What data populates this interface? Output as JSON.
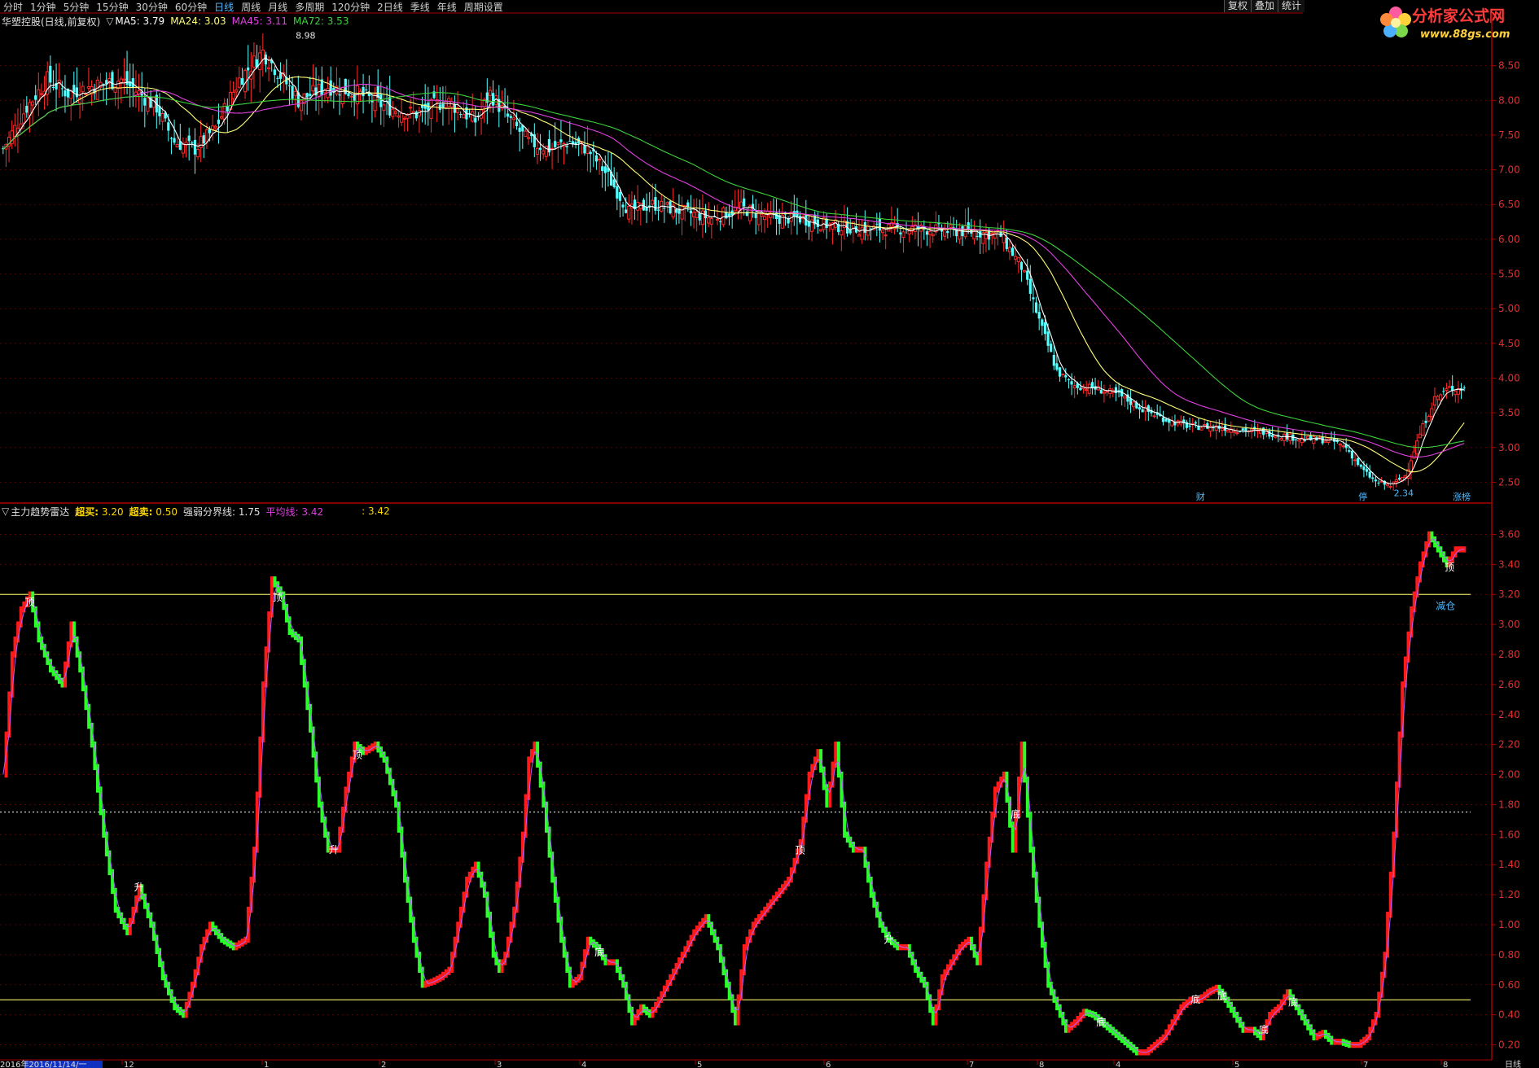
{
  "toolbar": {
    "periods": [
      "分时",
      "1分钟",
      "5分钟",
      "15分钟",
      "30分钟",
      "60分钟",
      "日线",
      "周线",
      "月线",
      "多周期",
      "120分钟",
      "2日线",
      "季线",
      "年线",
      "周期设置"
    ],
    "active": "日线",
    "right_buttons": [
      "复权",
      "叠加",
      "统计"
    ]
  },
  "logo": {
    "name": "分析家公式网",
    "url": "www.88gs.com"
  },
  "main_legend": {
    "title": "华塑控股(日线,前复权)",
    "ma5": "MA5: 3.79",
    "ma24": "MA24: 3.03",
    "ma45": "MA45: 3.11",
    "ma72": "MA72: 3.53"
  },
  "ind_legend": {
    "title": "主力趋势雷达",
    "buy_label": "超买:",
    "buy_value": "3.20",
    "sell_label": "超卖:",
    "sell_value": "0.50",
    "divider": "强弱分界线: 1.75",
    "avg": "平均线: 3.42",
    "val": ": 3.42"
  },
  "colors": {
    "up": "#ff2a2a",
    "down": "#54ffff",
    "ma5": "#ffffff",
    "ma24": "#ffff7a",
    "ma45": "#e040e0",
    "ma72": "#3cd23c",
    "ind_up": "#ff1a1a",
    "ind_down": "#2aff2a",
    "axis": "#aa0000",
    "grid": "#6a0000"
  },
  "price_axis": [
    "8.50",
    "8.00",
    "7.50",
    "7.00",
    "6.50",
    "6.00",
    "5.50",
    "5.00",
    "4.50",
    "4.00",
    "3.50",
    "3.00",
    "2.50"
  ],
  "ind_axis": [
    "3.60",
    "3.40",
    "3.20",
    "3.00",
    "2.80",
    "2.60",
    "2.40",
    "2.20",
    "2.00",
    "1.80",
    "1.60",
    "1.40",
    "1.20",
    "1.00",
    "0.80",
    "0.60",
    "0.40",
    "0.20"
  ],
  "date_bar": {
    "label": "2016年2016/11/14/一",
    "ticks": [
      "12",
      "1",
      "2",
      "3",
      "4",
      "5",
      "6",
      "7",
      "8",
      "4",
      "5",
      "7",
      "8"
    ],
    "period": "日线"
  },
  "chart_data": [
    {
      "type": "candlestick",
      "title": "华塑控股(日线,前复权)",
      "ylim": [
        2.2,
        9.0
      ],
      "series": [
        {
          "name": "MA5",
          "value": 3.79
        },
        {
          "name": "MA24",
          "value": 3.03
        },
        {
          "name": "MA45",
          "value": 3.11
        },
        {
          "name": "MA72",
          "value": 3.53
        }
      ],
      "close_anchors": [
        [
          0,
          7.3
        ],
        [
          8,
          7.9
        ],
        [
          15,
          8.3
        ],
        [
          22,
          8.1
        ],
        [
          30,
          8.2
        ],
        [
          40,
          8.3
        ],
        [
          52,
          7.9
        ],
        [
          58,
          7.4
        ],
        [
          65,
          7.3
        ],
        [
          72,
          7.6
        ],
        [
          80,
          8.3
        ],
        [
          88,
          8.7
        ],
        [
          95,
          8.3
        ],
        [
          100,
          8.0
        ],
        [
          110,
          8.2
        ],
        [
          120,
          8.1
        ],
        [
          130,
          7.9
        ],
        [
          140,
          7.8
        ],
        [
          150,
          8.0
        ],
        [
          160,
          7.7
        ],
        [
          165,
          8.1
        ],
        [
          170,
          7.8
        ],
        [
          178,
          7.4
        ],
        [
          185,
          7.3
        ],
        [
          192,
          7.4
        ],
        [
          198,
          7.3
        ],
        [
          205,
          6.9
        ],
        [
          212,
          6.4
        ],
        [
          220,
          6.5
        ],
        [
          230,
          6.4
        ],
        [
          240,
          6.3
        ],
        [
          250,
          6.45
        ],
        [
          260,
          6.3
        ],
        [
          270,
          6.3
        ],
        [
          280,
          6.2
        ],
        [
          290,
          6.15
        ],
        [
          300,
          6.15
        ],
        [
          310,
          6.15
        ],
        [
          320,
          6.12
        ],
        [
          330,
          6.1
        ],
        [
          338,
          6.05
        ],
        [
          345,
          5.6
        ],
        [
          352,
          4.7
        ],
        [
          357,
          4.1
        ],
        [
          362,
          3.9
        ],
        [
          370,
          3.85
        ],
        [
          378,
          3.75
        ],
        [
          386,
          3.55
        ],
        [
          394,
          3.4
        ],
        [
          402,
          3.3
        ],
        [
          410,
          3.3
        ],
        [
          420,
          3.25
        ],
        [
          430,
          3.2
        ],
        [
          440,
          3.12
        ],
        [
          450,
          3.1
        ],
        [
          455,
          3.0
        ],
        [
          460,
          2.7
        ],
        [
          465,
          2.5
        ],
        [
          470,
          2.45
        ],
        [
          475,
          2.6
        ],
        [
          480,
          3.2
        ],
        [
          485,
          3.7
        ],
        [
          490,
          3.85
        ]
      ],
      "annotations": [
        {
          "text": "8.98",
          "x": 98
        },
        {
          "text": "2.34",
          "x": 470
        },
        {
          "text": "财",
          "x": 403
        },
        {
          "text": "停",
          "x": 458
        },
        {
          "text": "涨榜",
          "x": 490
        }
      ]
    },
    {
      "type": "bar",
      "title": "主力趋势雷达",
      "ylim": [
        0.1,
        3.7
      ],
      "reference_lines": {
        "超买": 3.2,
        "超卖": 0.5,
        "强弱分界线": 1.75
      },
      "anchors": [
        [
          0,
          2.0
        ],
        [
          3,
          2.8
        ],
        [
          6,
          3.1
        ],
        [
          9,
          3.2
        ],
        [
          12,
          2.9
        ],
        [
          16,
          2.7
        ],
        [
          20,
          2.6
        ],
        [
          23,
          3.0
        ],
        [
          26,
          2.7
        ],
        [
          30,
          2.2
        ],
        [
          34,
          1.6
        ],
        [
          38,
          1.1
        ],
        [
          42,
          0.95
        ],
        [
          46,
          1.25
        ],
        [
          50,
          1.0
        ],
        [
          54,
          0.65
        ],
        [
          58,
          0.45
        ],
        [
          61,
          0.4
        ],
        [
          64,
          0.6
        ],
        [
          67,
          0.85
        ],
        [
          70,
          1.0
        ],
        [
          74,
          0.9
        ],
        [
          78,
          0.85
        ],
        [
          82,
          0.9
        ],
        [
          85,
          1.5
        ],
        [
          88,
          2.6
        ],
        [
          91,
          3.3
        ],
        [
          94,
          3.2
        ],
        [
          97,
          2.95
        ],
        [
          100,
          2.9
        ],
        [
          104,
          2.3
        ],
        [
          107,
          1.8
        ],
        [
          110,
          1.5
        ],
        [
          113,
          1.5
        ],
        [
          116,
          1.9
        ],
        [
          119,
          2.2
        ],
        [
          122,
          2.15
        ],
        [
          126,
          2.2
        ],
        [
          129,
          2.1
        ],
        [
          133,
          1.8
        ],
        [
          136,
          1.3
        ],
        [
          139,
          0.9
        ],
        [
          142,
          0.6
        ],
        [
          145,
          0.62
        ],
        [
          148,
          0.65
        ],
        [
          151,
          0.7
        ],
        [
          154,
          1.0
        ],
        [
          157,
          1.3
        ],
        [
          160,
          1.4
        ],
        [
          163,
          1.2
        ],
        [
          166,
          0.8
        ],
        [
          168,
          0.7
        ],
        [
          170,
          0.8
        ],
        [
          173,
          1.1
        ],
        [
          176,
          1.6
        ],
        [
          178,
          2.1
        ],
        [
          180,
          2.2
        ],
        [
          183,
          1.8
        ],
        [
          186,
          1.3
        ],
        [
          189,
          0.9
        ],
        [
          192,
          0.6
        ],
        [
          195,
          0.65
        ],
        [
          198,
          0.9
        ],
        [
          201,
          0.85
        ],
        [
          204,
          0.75
        ],
        [
          207,
          0.75
        ],
        [
          210,
          0.6
        ],
        [
          213,
          0.35
        ],
        [
          216,
          0.45
        ],
        [
          219,
          0.4
        ],
        [
          222,
          0.5
        ],
        [
          226,
          0.65
        ],
        [
          230,
          0.8
        ],
        [
          234,
          0.95
        ],
        [
          238,
          1.05
        ],
        [
          242,
          0.85
        ],
        [
          245,
          0.6
        ],
        [
          248,
          0.35
        ],
        [
          251,
          0.85
        ],
        [
          254,
          1.0
        ],
        [
          258,
          1.1
        ],
        [
          262,
          1.2
        ],
        [
          266,
          1.3
        ],
        [
          270,
          1.55
        ],
        [
          273,
          2.0
        ],
        [
          276,
          2.15
        ],
        [
          279,
          1.8
        ],
        [
          282,
          2.2
        ],
        [
          285,
          1.6
        ],
        [
          288,
          1.5
        ],
        [
          291,
          1.5
        ],
        [
          294,
          1.2
        ],
        [
          297,
          1.0
        ],
        [
          300,
          0.9
        ],
        [
          303,
          0.85
        ],
        [
          306,
          0.85
        ],
        [
          309,
          0.7
        ],
        [
          312,
          0.6
        ],
        [
          315,
          0.35
        ],
        [
          318,
          0.65
        ],
        [
          321,
          0.75
        ],
        [
          324,
          0.85
        ],
        [
          327,
          0.9
        ],
        [
          330,
          0.75
        ],
        [
          333,
          1.4
        ],
        [
          336,
          1.9
        ],
        [
          339,
          2.0
        ],
        [
          342,
          1.5
        ],
        [
          345,
          2.2
        ],
        [
          348,
          1.5
        ],
        [
          351,
          1.0
        ],
        [
          354,
          0.6
        ],
        [
          357,
          0.45
        ],
        [
          360,
          0.3
        ],
        [
          363,
          0.35
        ],
        [
          366,
          0.42
        ],
        [
          369,
          0.4
        ],
        [
          372,
          0.35
        ],
        [
          375,
          0.3
        ],
        [
          378,
          0.25
        ],
        [
          381,
          0.2
        ],
        [
          384,
          0.15
        ],
        [
          387,
          0.15
        ],
        [
          390,
          0.2
        ],
        [
          393,
          0.25
        ],
        [
          396,
          0.35
        ],
        [
          399,
          0.45
        ],
        [
          402,
          0.5
        ],
        [
          405,
          0.5
        ],
        [
          408,
          0.55
        ],
        [
          411,
          0.58
        ],
        [
          414,
          0.5
        ],
        [
          417,
          0.4
        ],
        [
          420,
          0.3
        ],
        [
          423,
          0.3
        ],
        [
          426,
          0.25
        ],
        [
          429,
          0.4
        ],
        [
          432,
          0.45
        ],
        [
          435,
          0.55
        ],
        [
          438,
          0.45
        ],
        [
          441,
          0.35
        ],
        [
          444,
          0.25
        ],
        [
          447,
          0.28
        ],
        [
          450,
          0.22
        ],
        [
          453,
          0.22
        ],
        [
          456,
          0.2
        ],
        [
          459,
          0.2
        ],
        [
          462,
          0.25
        ],
        [
          465,
          0.4
        ],
        [
          468,
          0.8
        ],
        [
          471,
          1.6
        ],
        [
          474,
          2.6
        ],
        [
          477,
          3.1
        ],
        [
          480,
          3.4
        ],
        [
          483,
          3.6
        ],
        [
          486,
          3.5
        ],
        [
          489,
          3.4
        ],
        [
          492,
          3.5
        ]
      ],
      "signals": [
        {
          "text": "顶",
          "x": 9
        },
        {
          "text": "升",
          "x": 46
        },
        {
          "text": "顶",
          "x": 93
        },
        {
          "text": "升",
          "x": 112
        },
        {
          "text": "顶",
          "x": 120
        },
        {
          "text": "底",
          "x": 202
        },
        {
          "text": "顶",
          "x": 270
        },
        {
          "text": "升",
          "x": 300
        },
        {
          "text": "底",
          "x": 343
        },
        {
          "text": "底",
          "x": 372
        },
        {
          "text": "底",
          "x": 404
        },
        {
          "text": "底",
          "x": 413
        },
        {
          "text": "底",
          "x": 427
        },
        {
          "text": "底",
          "x": 437
        },
        {
          "text": "顶",
          "x": 490
        },
        {
          "text": "减仓",
          "x": 487
        }
      ]
    }
  ]
}
